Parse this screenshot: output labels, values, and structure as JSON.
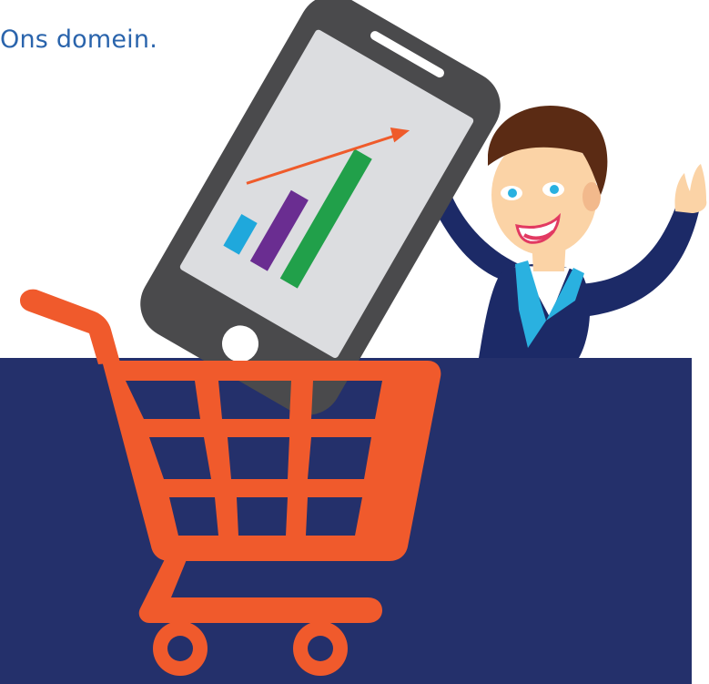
{
  "heading": {
    "text": "Ons domein."
  },
  "colors": {
    "heading": "#2a64ac",
    "navy_panel": "#24306b",
    "cart": "#f05a2c",
    "phone_body": "#4a4a4c",
    "phone_screen": "#dcdde0",
    "chart_bar_1": "#1fa8dc",
    "chart_bar_2": "#6a2d91",
    "chart_bar_3": "#21a04a",
    "trend_arrow": "#ef5b2b",
    "suit": "#1c2a67",
    "suit_lapel": "#2ab1e0",
    "skin": "#fbd3a6",
    "hair": "#5b2b14"
  },
  "illustration": {
    "subject": "man-holding-phone-with-growth-chart-in-shopping-cart",
    "phone_chart": {
      "bar_count": 3,
      "trend": "upward"
    }
  }
}
